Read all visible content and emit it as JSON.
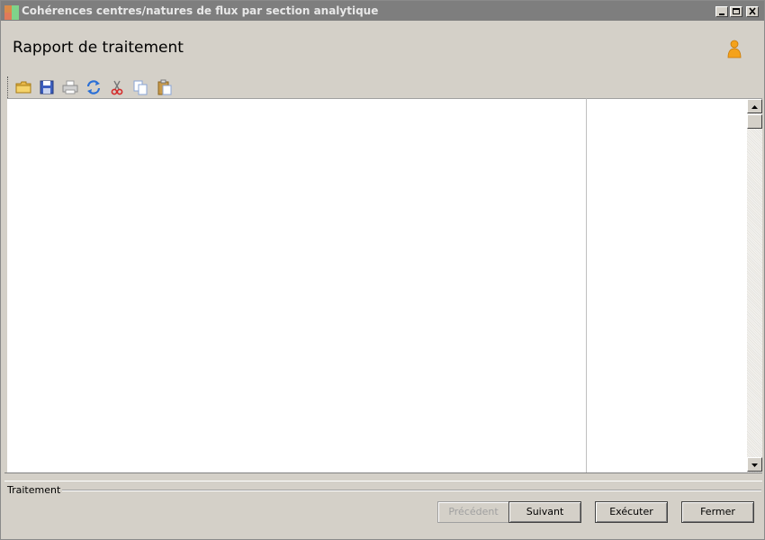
{
  "window": {
    "title": "Cohérences centres/natures de flux par section analytique"
  },
  "header": {
    "title": "Rapport de traitement"
  },
  "toolbar": {
    "items": [
      "open-icon",
      "save-icon",
      "print-icon",
      "refresh-icon",
      "cut-icon",
      "copy-icon",
      "paste-icon"
    ]
  },
  "group": {
    "label": "Traitement"
  },
  "buttons": {
    "previous": "Précédent",
    "next": "Suivant",
    "execute": "Exécuter",
    "close": "Fermer"
  }
}
